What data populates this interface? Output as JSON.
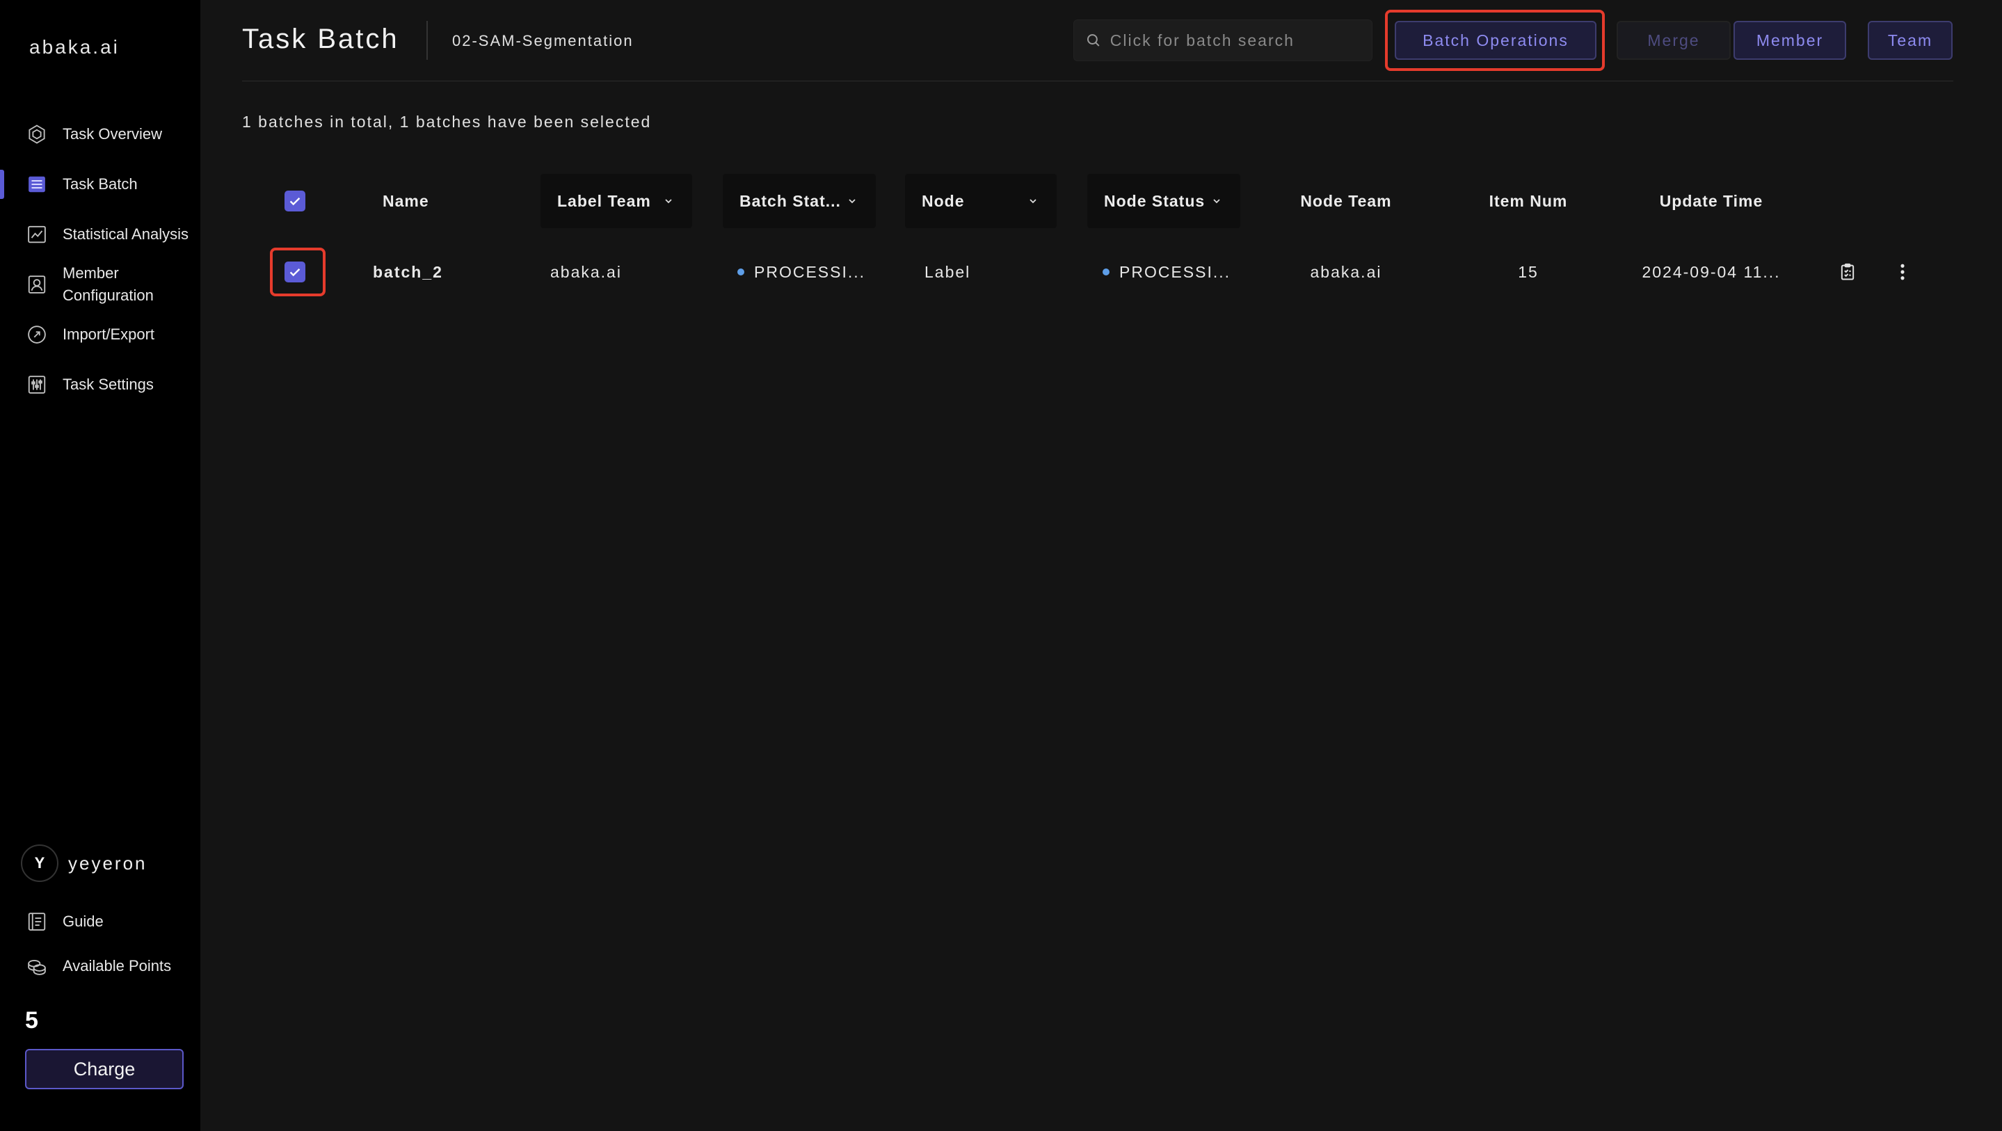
{
  "sidebar": {
    "brand": "abaka.ai",
    "items": [
      {
        "label": "Task Overview",
        "icon": "cube-icon",
        "active": false
      },
      {
        "label": "Task Batch",
        "icon": "list-icon",
        "active": true
      },
      {
        "label": "Statistical Analysis",
        "icon": "chart-icon",
        "active": false
      },
      {
        "label": "Member Configuration",
        "icon": "member-icon",
        "active": false
      },
      {
        "label": "Import/Export",
        "icon": "import-export-icon",
        "active": false
      },
      {
        "label": "Task Settings",
        "icon": "settings-sliders-icon",
        "active": false
      }
    ],
    "user": {
      "initial": "Y",
      "name": "yeyeron"
    },
    "guide_label": "Guide",
    "points_label": "Available Points",
    "points_value": "5",
    "charge_label": "Charge"
  },
  "header": {
    "title": "Task Batch",
    "task_name": "02-SAM-Segmentation",
    "search_placeholder": "Click for batch search",
    "buttons": {
      "batch_operations": "Batch Operations",
      "merge": "Merge",
      "member": "Member",
      "team": "Team"
    }
  },
  "summary": "1 batches in total, 1 batches have been selected",
  "table": {
    "columns": {
      "name": "Name",
      "label_team": "Label Team",
      "batch_status": "Batch Stat...",
      "node": "Node",
      "node_status": "Node Status",
      "node_team": "Node Team",
      "item_num": "Item Num",
      "update_time": "Update Time"
    },
    "rows": [
      {
        "name": "batch_2",
        "label_team": "abaka.ai",
        "batch_status": "PROCESSI...",
        "node": "Label",
        "node_status": "PROCESSI...",
        "node_team": "abaka.ai",
        "item_num": "15",
        "update_time": "2024-09-04 11..."
      }
    ]
  },
  "colors": {
    "accent": "#5b5bd6",
    "highlight": "#e53b2c",
    "status_dot": "#5e9ee8"
  }
}
